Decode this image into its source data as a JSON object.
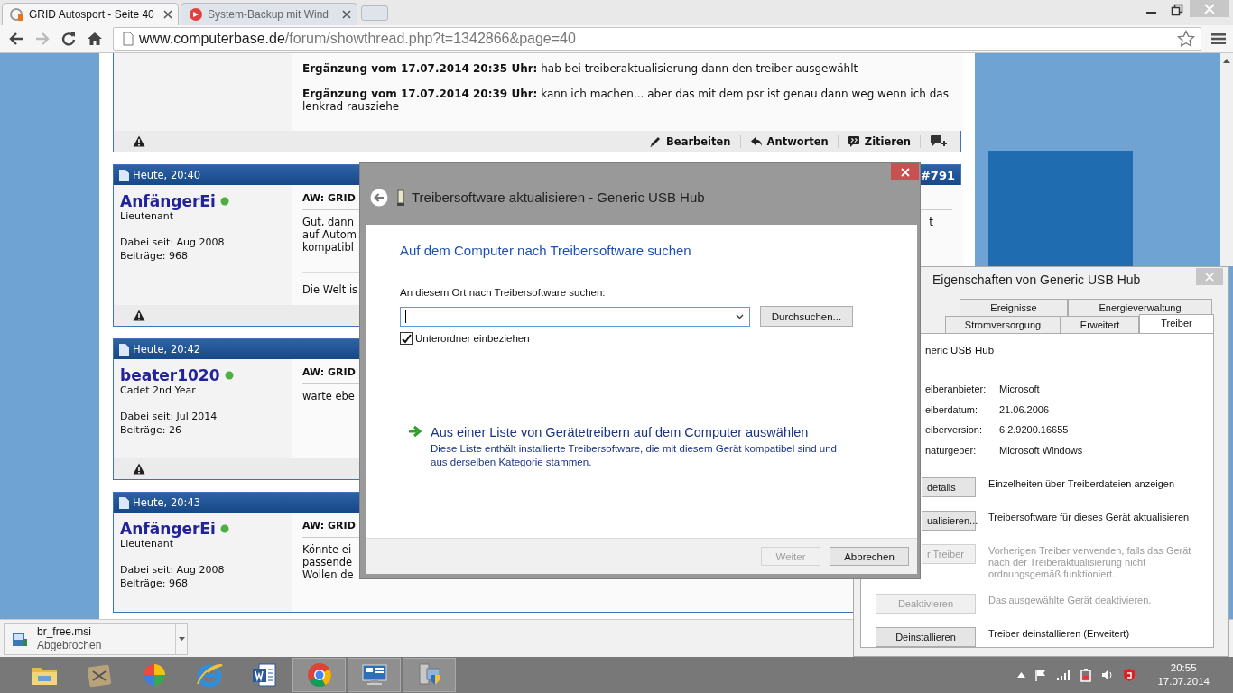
{
  "browser": {
    "tabs": [
      {
        "title": "GRID Autosport - Seite 40",
        "selected": true
      },
      {
        "title": "System-Backup mit Wind",
        "selected": false
      }
    ],
    "address": {
      "host": "www.computerbase.de",
      "path": "/forum/showthread.php?t=1342866&page=40"
    }
  },
  "forum": {
    "first_post": {
      "additions": [
        {
          "label": "Ergänzung vom 17.07.2014 20:35 Uhr:",
          "text": "hab bei treiberaktualisierung dann den treiber ausgewählt"
        },
        {
          "label": "Ergänzung vom 17.07.2014 20:39 Uhr:",
          "text": "kann ich machen... aber das mit dem psr ist genau dann weg wenn ich das lenkrad rausziehe"
        }
      ],
      "actions": [
        "Bearbeiten",
        "Antworten",
        "Zitieren"
      ]
    },
    "posts": [
      {
        "time": "Heute, 20:40",
        "number": "#791",
        "user": "AnfängerEi",
        "online": true,
        "rank": "Lieutenant",
        "joined": "Dabei seit: Aug 2008",
        "count": "Beiträge: 968",
        "title": "AW: GRID",
        "lines": [
          "Gut, dann",
          "auf Autom",
          "kompatibl"
        ],
        "aside": "t",
        "signature": "Die Welt is"
      },
      {
        "time": "Heute, 20:42",
        "user": "beater1020",
        "online": true,
        "rank": "Cadet 2nd Year",
        "joined": "Dabei seit: Jul 2014",
        "count": "Beiträge: 26",
        "title": "AW: GRID",
        "lines": [
          "warte ebe"
        ]
      },
      {
        "time": "Heute, 20:43",
        "user": "AnfängerEi",
        "online": true,
        "rank": "Lieutenant",
        "joined": "Dabei seit: Aug 2008",
        "count": "Beiträge: 968",
        "title": "AW: GRID",
        "lines": [
          "Könnte ei",
          "passende",
          "Wollen de"
        ]
      }
    ]
  },
  "download": {
    "file": "br_free.msi",
    "status": "Abgebrochen"
  },
  "wizard": {
    "title": "Treibersoftware aktualisieren - Generic USB Hub",
    "heading": "Auf dem Computer nach Treibersoftware suchen",
    "field_label": "An diesem Ort nach Treibersoftware suchen:",
    "browse": "Durchsuchen...",
    "checkbox": {
      "label": "Unterordner einbeziehen",
      "checked": true
    },
    "option": {
      "title": "Aus einer Liste von Gerätetreibern auf dem Computer auswählen",
      "description": "Diese Liste enthält installierte Treibersoftware, die mit diesem Gerät kompatibel sind und aus derselben Kategorie stammen."
    },
    "buttons": [
      {
        "label": "Weiter",
        "disabled": true
      },
      {
        "label": "Abbrechen",
        "disabled": false
      }
    ]
  },
  "properties": {
    "title": "Eigenschaften von Generic USB Hub",
    "tab_rows": [
      [
        {
          "label": "Ereignisse",
          "selected": false
        },
        {
          "label": "Energieverwaltung",
          "selected": false
        }
      ],
      [
        {
          "label": "Stromversorgung",
          "selected": false
        },
        {
          "label": "Erweitert",
          "selected": false
        },
        {
          "label": "Treiber",
          "selected": true
        }
      ]
    ],
    "device": "neric USB Hub",
    "fields": [
      {
        "label": "eiberanbieter:",
        "value": "Microsoft"
      },
      {
        "label": "eiberdatum:",
        "value": "21.06.2006"
      },
      {
        "label": "eiberversion:",
        "value": "6.2.9200.16655"
      },
      {
        "label": "naturgeber:",
        "value": "Microsoft Windows"
      }
    ],
    "actions": [
      {
        "kind": "cut",
        "button": "details",
        "text": "Einzelheiten über Treiberdateien anzeigen",
        "disabled": false
      },
      {
        "kind": "cut",
        "button": "ualisieren...",
        "text": "Treibersoftware für dieses Gerät aktualisieren",
        "disabled": false
      },
      {
        "kind": "cut",
        "button": "r Treiber",
        "text": "Vorherigen Treiber verwenden, falls das Gerät nach der Treiberaktualisierung nicht ordnungsgemäß funktioniert.",
        "disabled": true
      },
      {
        "kind": "full",
        "button": "Deaktivieren",
        "text": "Das ausgewählte Gerät deaktivieren.",
        "disabled": true
      },
      {
        "kind": "full",
        "button": "Deinstallieren",
        "text": "Treiber deinstallieren (Erweitert)",
        "disabled": false
      }
    ]
  },
  "taskbar": {
    "items": [
      {
        "open": false
      },
      {
        "open": false
      },
      {
        "open": false
      },
      {
        "open": false
      },
      {
        "open": false
      },
      {
        "open": true
      },
      {
        "open": true
      },
      {
        "open": true
      }
    ],
    "time": "20:55",
    "date": "17.07.2014"
  }
}
